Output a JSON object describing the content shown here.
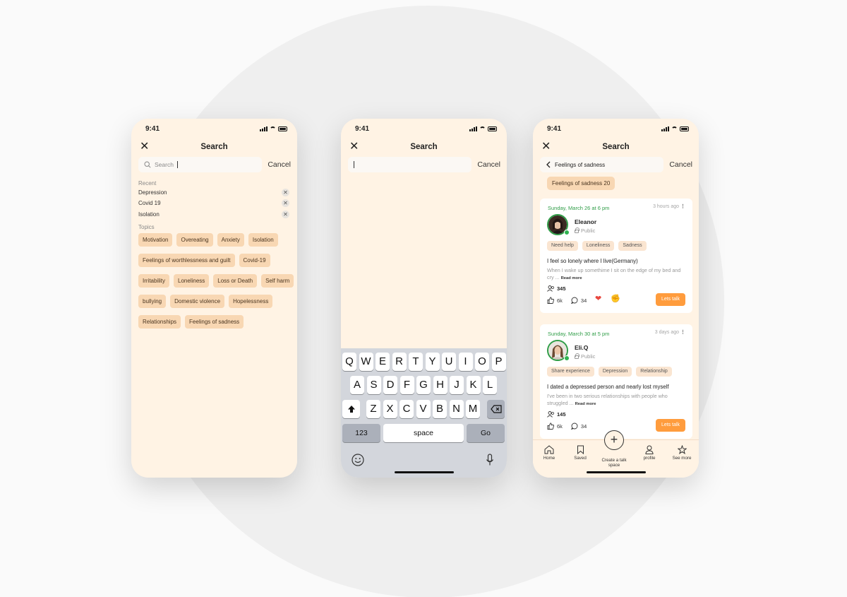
{
  "phone1": {
    "time": "9:41",
    "title": "Search",
    "search_placeholder": "Search",
    "cancel": "Cancel",
    "recent_label": "Recent",
    "recent": [
      "Depression",
      "Covid 19",
      "Isolation"
    ],
    "topics_label": "Topics",
    "topics": [
      "Motivation",
      "Overeating",
      "Anxiety",
      "Isolation",
      "Feelings of worthlessness and guilt",
      "Covid-19",
      "Irritability",
      "Loneliness",
      "Loss or Death",
      "Self harm",
      "bullying",
      "Domestic violence",
      "Hopelessness",
      "Relationships",
      "Feelings of sadness"
    ]
  },
  "phone2": {
    "time": "9:41",
    "title": "Search",
    "cancel": "Cancel",
    "keyboard": {
      "row1": [
        "Q",
        "W",
        "E",
        "R",
        "T",
        "Y",
        "U",
        "I",
        "O",
        "P"
      ],
      "row2": [
        "A",
        "S",
        "D",
        "F",
        "G",
        "H",
        "J",
        "K",
        "L"
      ],
      "row3": [
        "Z",
        "X",
        "C",
        "V",
        "B",
        "N",
        "M"
      ],
      "numbers_key": "123",
      "space_key": "space",
      "go_key": "Go"
    }
  },
  "phone3": {
    "time": "9:41",
    "title": "Search",
    "search_value": "Feelings of sadness",
    "cancel": "Cancel",
    "result_tag": "Feelings of sadness 20",
    "posts": [
      {
        "date": "Sunday, March 26 at 6 pm",
        "ago": "3 hours ago",
        "user": "Eleanor",
        "visibility": "Public",
        "tags": [
          "Need help",
          "Loneliness",
          "Sadness"
        ],
        "title": "I feel so lonely where I live(Germany)",
        "body": "When I wake up somethime I sit on the edge of my bed and cry ...",
        "read_more": "Read more",
        "members": "345",
        "likes": "6k",
        "comments": "34",
        "cta": "Lets talk"
      },
      {
        "date": "Sunday, March 30 at 5 pm",
        "ago": "3 days ago",
        "user": "Eli.Q",
        "visibility": "Public",
        "tags": [
          "Share experience",
          "Depression",
          "Relationship"
        ],
        "title": "I dated a depressed person and nearly lost myself",
        "body": "I've been in two serious relationships with people who struggled ...",
        "read_more": "Read more",
        "members": "145",
        "likes": "6k",
        "comments": "34",
        "cta": "Lets talk"
      }
    ],
    "tabs": {
      "home": "Home",
      "saved": "Saved",
      "create": "Create a talk space",
      "profile": "profile",
      "more": "See more"
    }
  },
  "colors": {
    "phone_bg": "#fff3e4",
    "chip": "#f8d7b3",
    "accent": "#ff9c3d",
    "green": "#2f9d47"
  }
}
